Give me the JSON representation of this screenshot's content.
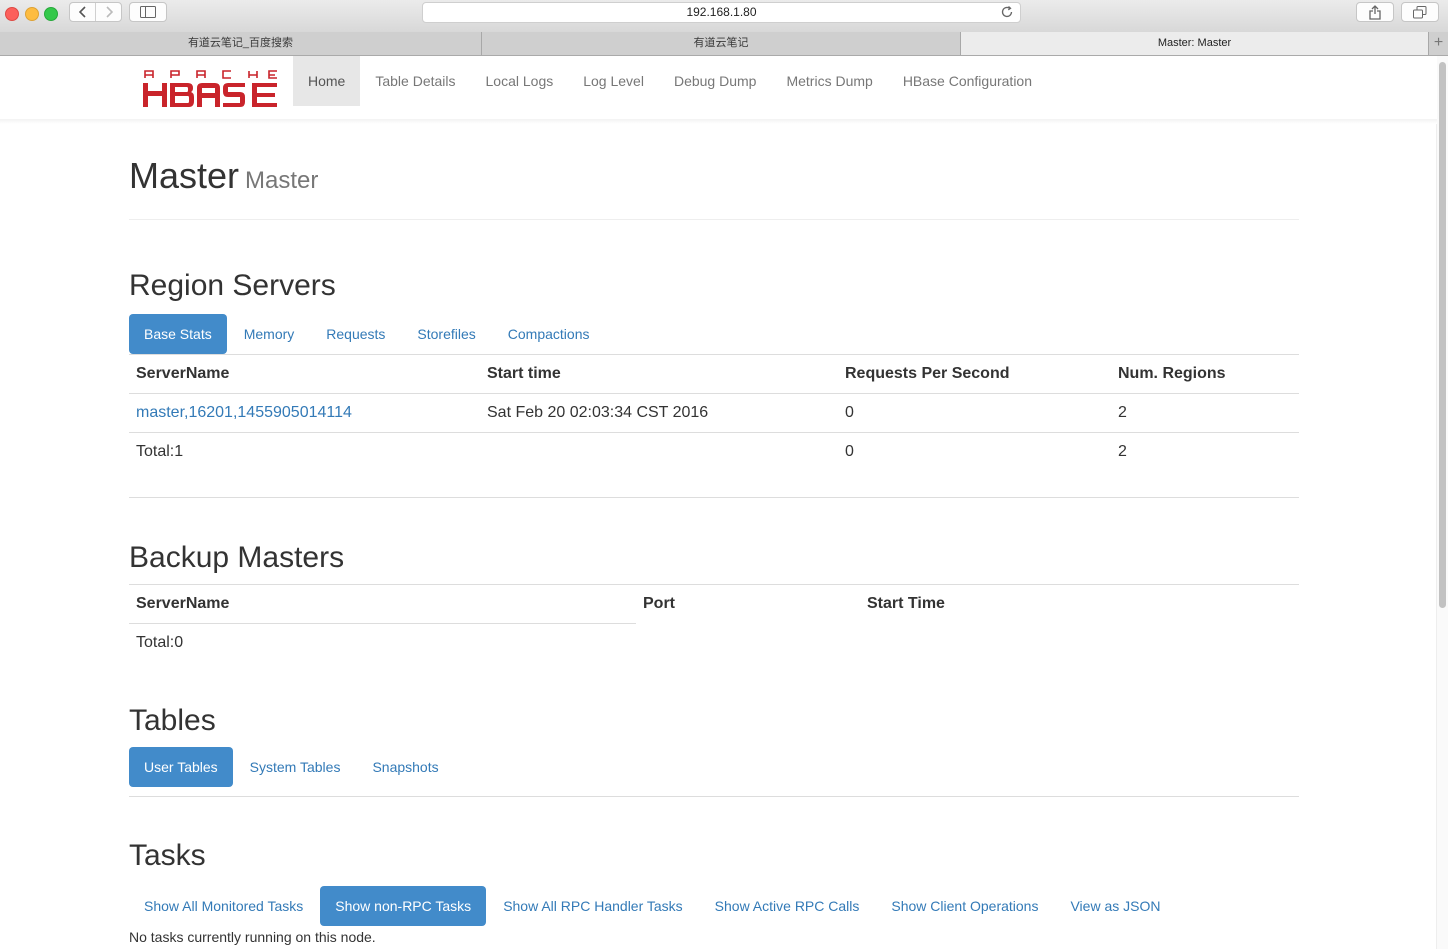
{
  "browser": {
    "address": "192.168.1.80",
    "tabs": [
      {
        "label": "有道云笔记_百度搜索",
        "active": false
      },
      {
        "label": "有道云笔记",
        "active": false
      },
      {
        "label": "Master: Master",
        "active": true
      }
    ]
  },
  "logo": {
    "apache_text": "APACHE",
    "hbase_text": "HBASE",
    "color": "#c9242b"
  },
  "nav": [
    {
      "label": "Home",
      "active": true
    },
    {
      "label": "Table Details",
      "active": false
    },
    {
      "label": "Local Logs",
      "active": false
    },
    {
      "label": "Log Level",
      "active": false
    },
    {
      "label": "Debug Dump",
      "active": false
    },
    {
      "label": "Metrics Dump",
      "active": false
    },
    {
      "label": "HBase Configuration",
      "active": false
    }
  ],
  "page_header": {
    "title": "Master",
    "subtitle": "Master"
  },
  "region_servers": {
    "heading": "Region Servers",
    "tabs": [
      {
        "label": "Base Stats",
        "active": true
      },
      {
        "label": "Memory",
        "active": false
      },
      {
        "label": "Requests",
        "active": false
      },
      {
        "label": "Storefiles",
        "active": false
      },
      {
        "label": "Compactions",
        "active": false
      }
    ],
    "columns": [
      "ServerName",
      "Start time",
      "Requests Per Second",
      "Num. Regions"
    ],
    "rows": [
      {
        "server": "master,16201,1455905014114",
        "start_time": "Sat Feb 20 02:03:34 CST 2016",
        "rps": "0",
        "regions": "2"
      }
    ],
    "total": {
      "label": "Total:1",
      "rps": "0",
      "regions": "2"
    }
  },
  "backup_masters": {
    "heading": "Backup Masters",
    "columns": [
      "ServerName",
      "Port",
      "Start Time"
    ],
    "total": "Total:0"
  },
  "tables": {
    "heading": "Tables",
    "tabs": [
      {
        "label": "User Tables",
        "active": true
      },
      {
        "label": "System Tables",
        "active": false
      },
      {
        "label": "Snapshots",
        "active": false
      }
    ]
  },
  "tasks": {
    "heading": "Tasks",
    "tabs": [
      {
        "label": "Show All Monitored Tasks",
        "active": false
      },
      {
        "label": "Show non-RPC Tasks",
        "active": true
      },
      {
        "label": "Show All RPC Handler Tasks",
        "active": false
      },
      {
        "label": "Show Active RPC Calls",
        "active": false
      },
      {
        "label": "Show Client Operations",
        "active": false
      },
      {
        "label": "View as JSON",
        "active": false
      }
    ],
    "note": "No tasks currently running on this node."
  },
  "colors": {
    "link": "#337ab7",
    "pill_active": "#428bca"
  }
}
